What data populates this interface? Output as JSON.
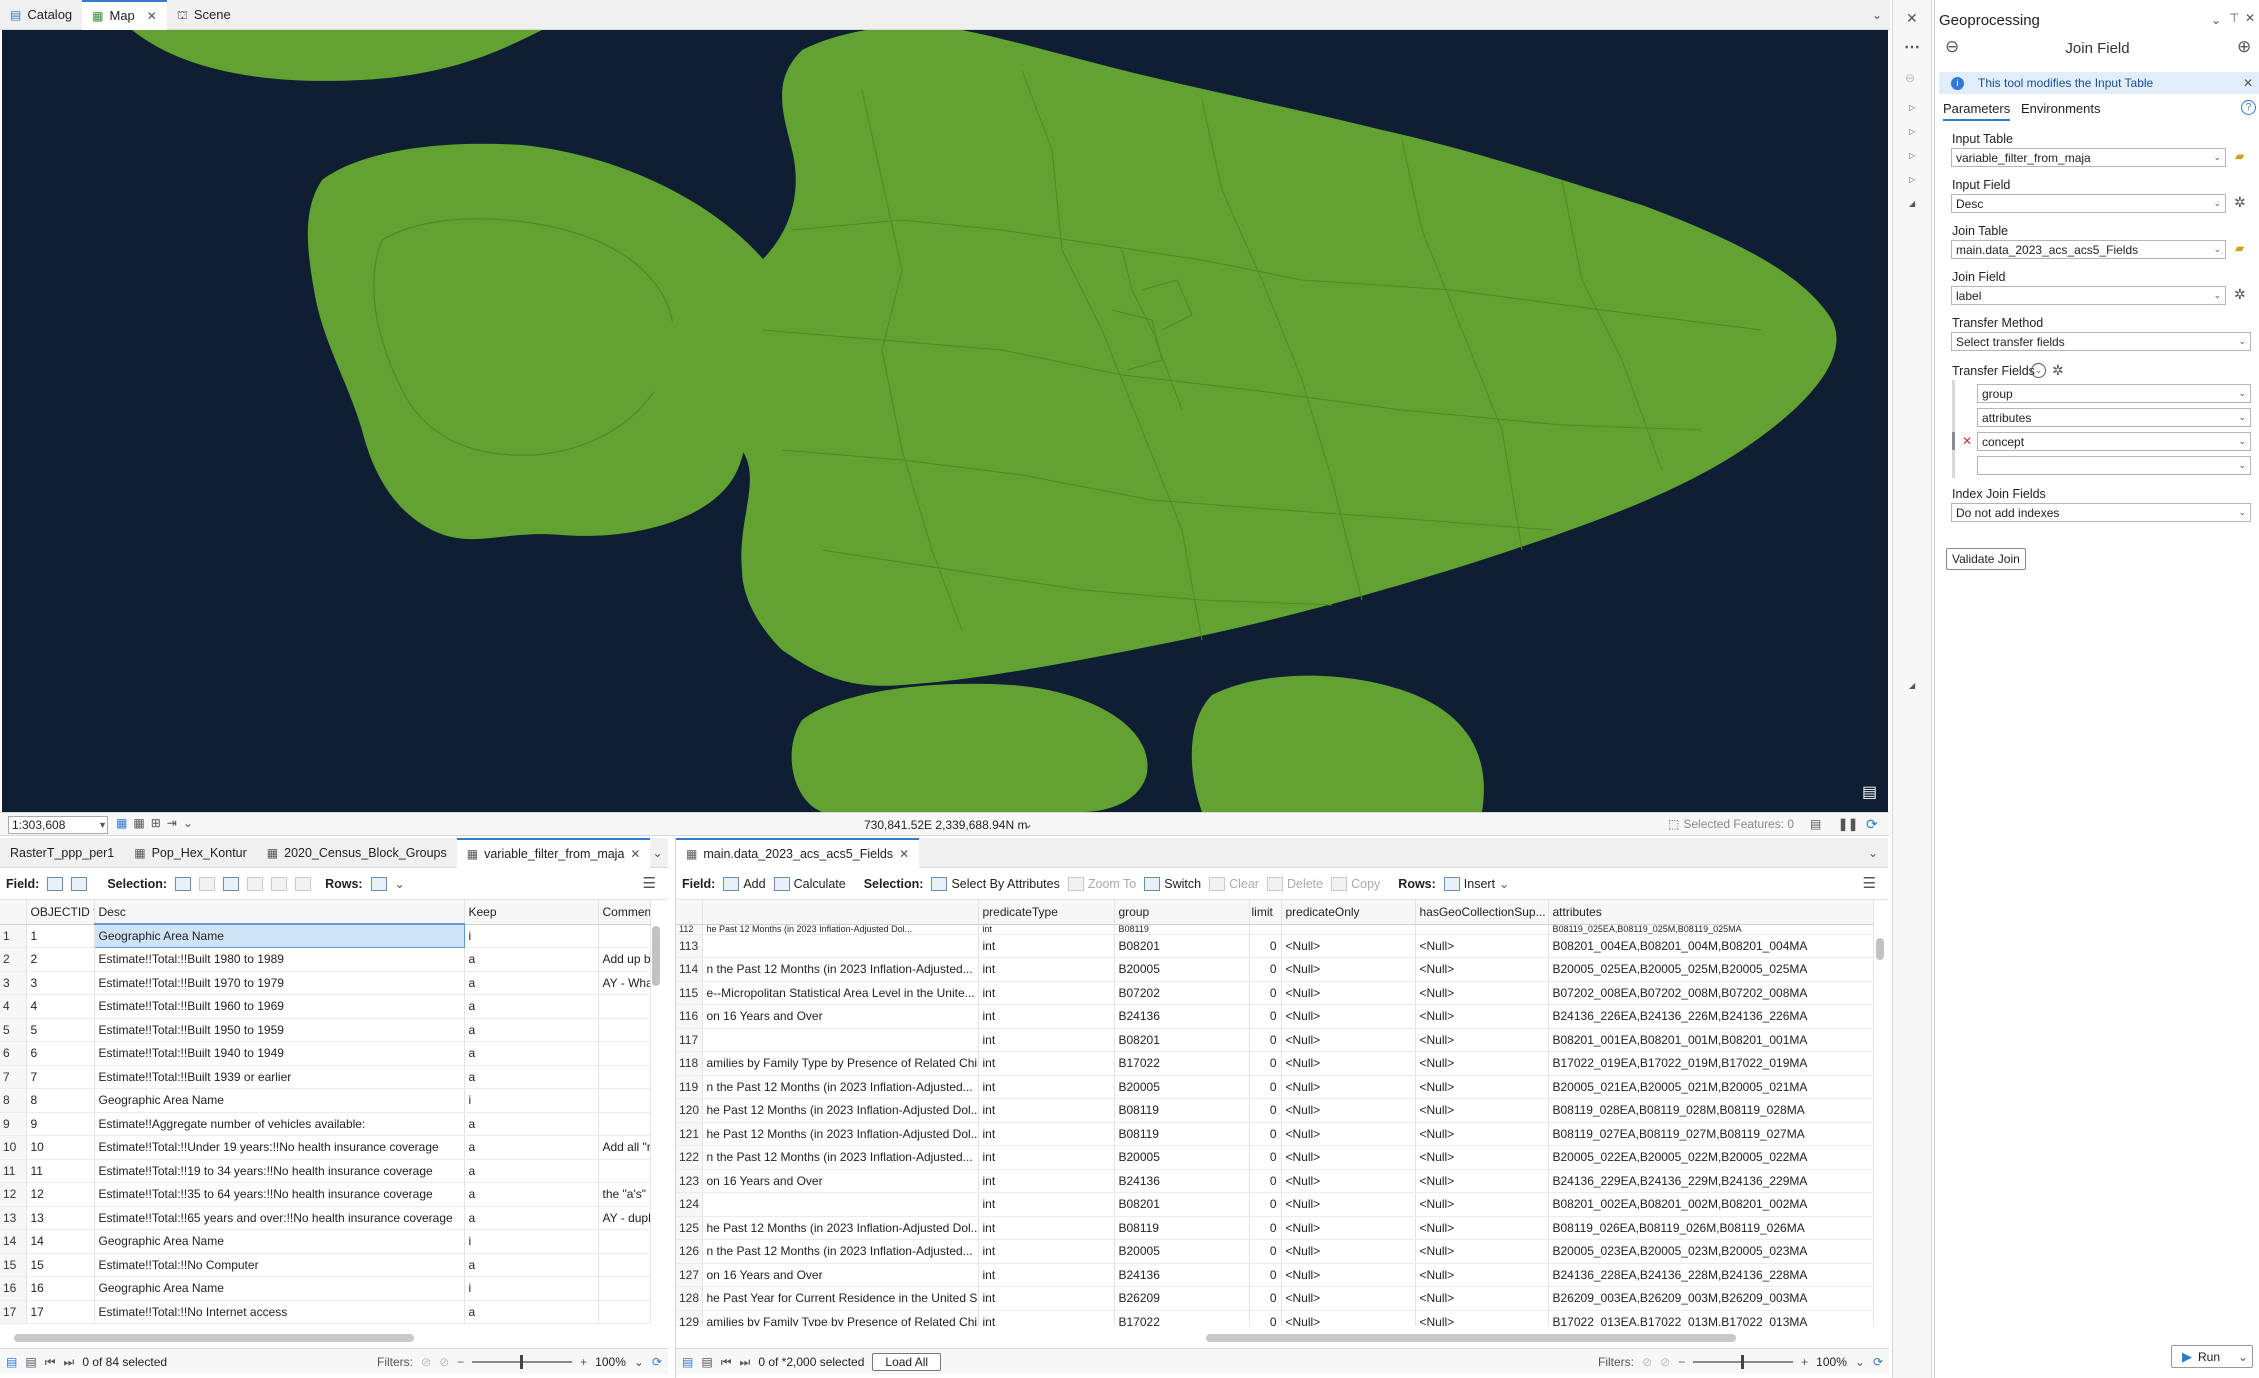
{
  "view_tabs": [
    {
      "label": "Catalog"
    },
    {
      "label": "Map"
    },
    {
      "label": "Scene"
    }
  ],
  "map": {
    "scale": "1:303,608",
    "coordinates": "730,841.52E 2,339,688.94N m",
    "selected_features": "Selected Features: 0",
    "colors": {
      "land": "#62a232",
      "water": "#0f1e33"
    }
  },
  "left_pane": {
    "tabs": [
      "RasterT_ppp_per1",
      "Pop_Hex_Kontur",
      "2020_Census_Block_Groups",
      "variable_filter_from_maja"
    ],
    "toolbar": {
      "field_label": "Field:",
      "selection_label": "Selection:",
      "rows_label": "Rows:"
    },
    "columns": [
      "OBJECTID *",
      "Desc",
      "Keep",
      "Commen"
    ],
    "rows": [
      {
        "n": "1",
        "id": "1",
        "desc": "Geographic Area Name",
        "keep": "i",
        "comment": ""
      },
      {
        "n": "2",
        "id": "2",
        "desc": "Estimate!!Total:!!Built 1980 to 1989",
        "keep": "a",
        "comment": "Add up b"
      },
      {
        "n": "3",
        "id": "3",
        "desc": "Estimate!!Total:!!Built 1970 to 1979",
        "keep": "a",
        "comment": "AY - What"
      },
      {
        "n": "4",
        "id": "4",
        "desc": "Estimate!!Total:!!Built 1960 to 1969",
        "keep": "a",
        "comment": ""
      },
      {
        "n": "5",
        "id": "5",
        "desc": "Estimate!!Total:!!Built 1950 to 1959",
        "keep": "a",
        "comment": ""
      },
      {
        "n": "6",
        "id": "6",
        "desc": "Estimate!!Total:!!Built 1940 to 1949",
        "keep": "a",
        "comment": ""
      },
      {
        "n": "7",
        "id": "7",
        "desc": "Estimate!!Total:!!Built 1939 or earlier",
        "keep": "a",
        "comment": ""
      },
      {
        "n": "8",
        "id": "8",
        "desc": "Geographic Area Name",
        "keep": "i",
        "comment": ""
      },
      {
        "n": "9",
        "id": "9",
        "desc": "Estimate!!Aggregate number of vehicles available:",
        "keep": "a",
        "comment": ""
      },
      {
        "n": "10",
        "id": "10",
        "desc": "Estimate!!Total:!!Under 19 years:!!No health insurance coverage",
        "keep": "a",
        "comment": "Add all \"r"
      },
      {
        "n": "11",
        "id": "11",
        "desc": "Estimate!!Total:!!19 to 34 years:!!No health insurance coverage",
        "keep": "a",
        "comment": ""
      },
      {
        "n": "12",
        "id": "12",
        "desc": "Estimate!!Total:!!35 to 64 years:!!No health insurance coverage",
        "keep": "a",
        "comment": "the \"a's\" i"
      },
      {
        "n": "13",
        "id": "13",
        "desc": "Estimate!!Total:!!65 years and over:!!No health insurance coverage",
        "keep": "a",
        "comment": "AY - dupli"
      },
      {
        "n": "14",
        "id": "14",
        "desc": "Geographic Area Name",
        "keep": "i",
        "comment": ""
      },
      {
        "n": "15",
        "id": "15",
        "desc": "Estimate!!Total:!!No Computer",
        "keep": "a",
        "comment": ""
      },
      {
        "n": "16",
        "id": "16",
        "desc": "Geographic Area Name",
        "keep": "i",
        "comment": ""
      },
      {
        "n": "17",
        "id": "17",
        "desc": "Estimate!!Total:!!No Internet access",
        "keep": "a",
        "comment": ""
      }
    ],
    "status": {
      "selected": "0 of 84 selected",
      "filters": "Filters:",
      "zoom": "100%"
    }
  },
  "right_pane": {
    "tab": "main.data_2023_acs_acs5_Fields",
    "toolbar": {
      "field_label": "Field:",
      "add": "Add",
      "calculate": "Calculate",
      "selection_label": "Selection:",
      "select_by_attributes": "Select By Attributes",
      "zoom_to": "Zoom To",
      "switch": "Switch",
      "clear": "Clear",
      "delete": "Delete",
      "copy": "Copy",
      "rows_label": "Rows:",
      "insert": "Insert"
    },
    "columns": [
      "",
      "predicateType",
      "group",
      "limit",
      "predicateOnly",
      "hasGeoCollectionSup...",
      "attributes"
    ],
    "partial_row": {
      "n": "112",
      "label": "he Past 12 Months (in 2023 Inflation-Adjusted Dol...",
      "type": "int",
      "group": "B08119",
      "attr": "B08119_025EA,B08119_025M,B08119_025MA"
    },
    "rows": [
      {
        "n": "113",
        "label": "",
        "type": "int",
        "group": "B08201",
        "limit": "0",
        "po": "<Null>",
        "geo": "<Null>",
        "attr": "B08201_004EA,B08201_004M,B08201_004MA"
      },
      {
        "n": "114",
        "label": "n the Past 12 Months (in 2023 Inflation-Adjusted...",
        "type": "int",
        "group": "B20005",
        "limit": "0",
        "po": "<Null>",
        "geo": "<Null>",
        "attr": "B20005_025EA,B20005_025M,B20005_025MA"
      },
      {
        "n": "115",
        "label": "e--Micropolitan Statistical Area Level in the Unite...",
        "type": "int",
        "group": "B07202",
        "limit": "0",
        "po": "<Null>",
        "geo": "<Null>",
        "attr": "B07202_008EA,B07202_008M,B07202_008MA"
      },
      {
        "n": "116",
        "label": "on 16 Years and Over",
        "type": "int",
        "group": "B24136",
        "limit": "0",
        "po": "<Null>",
        "geo": "<Null>",
        "attr": "B24136_226EA,B24136_226M,B24136_226MA"
      },
      {
        "n": "117",
        "label": "",
        "type": "int",
        "group": "B08201",
        "limit": "0",
        "po": "<Null>",
        "geo": "<Null>",
        "attr": "B08201_001EA,B08201_001M,B08201_001MA"
      },
      {
        "n": "118",
        "label": "amilies by Family Type by Presence of Related Chil...",
        "type": "int",
        "group": "B17022",
        "limit": "0",
        "po": "<Null>",
        "geo": "<Null>",
        "attr": "B17022_019EA,B17022_019M,B17022_019MA"
      },
      {
        "n": "119",
        "label": "n the Past 12 Months (in 2023 Inflation-Adjusted...",
        "type": "int",
        "group": "B20005",
        "limit": "0",
        "po": "<Null>",
        "geo": "<Null>",
        "attr": "B20005_021EA,B20005_021M,B20005_021MA"
      },
      {
        "n": "120",
        "label": "he Past 12 Months (in 2023 Inflation-Adjusted Dol...",
        "type": "int",
        "group": "B08119",
        "limit": "0",
        "po": "<Null>",
        "geo": "<Null>",
        "attr": "B08119_028EA,B08119_028M,B08119_028MA"
      },
      {
        "n": "121",
        "label": "he Past 12 Months (in 2023 Inflation-Adjusted Dol...",
        "type": "int",
        "group": "B08119",
        "limit": "0",
        "po": "<Null>",
        "geo": "<Null>",
        "attr": "B08119_027EA,B08119_027M,B08119_027MA"
      },
      {
        "n": "122",
        "label": "n the Past 12 Months (in 2023 Inflation-Adjusted...",
        "type": "int",
        "group": "B20005",
        "limit": "0",
        "po": "<Null>",
        "geo": "<Null>",
        "attr": "B20005_022EA,B20005_022M,B20005_022MA"
      },
      {
        "n": "123",
        "label": "on 16 Years and Over",
        "type": "int",
        "group": "B24136",
        "limit": "0",
        "po": "<Null>",
        "geo": "<Null>",
        "attr": "B24136_229EA,B24136_229M,B24136_229MA"
      },
      {
        "n": "124",
        "label": "",
        "type": "int",
        "group": "B08201",
        "limit": "0",
        "po": "<Null>",
        "geo": "<Null>",
        "attr": "B08201_002EA,B08201_002M,B08201_002MA"
      },
      {
        "n": "125",
        "label": "he Past 12 Months (in 2023 Inflation-Adjusted Dol...",
        "type": "int",
        "group": "B08119",
        "limit": "0",
        "po": "<Null>",
        "geo": "<Null>",
        "attr": "B08119_026EA,B08119_026M,B08119_026MA"
      },
      {
        "n": "126",
        "label": "n the Past 12 Months (in 2023 Inflation-Adjusted...",
        "type": "int",
        "group": "B20005",
        "limit": "0",
        "po": "<Null>",
        "geo": "<Null>",
        "attr": "B20005_023EA,B20005_023M,B20005_023MA"
      },
      {
        "n": "127",
        "label": "on 16 Years and Over",
        "type": "int",
        "group": "B24136",
        "limit": "0",
        "po": "<Null>",
        "geo": "<Null>",
        "attr": "B24136_228EA,B24136_228M,B24136_228MA"
      },
      {
        "n": "128",
        "label": "he Past Year for Current Residence in the United S...",
        "type": "int",
        "group": "B26209",
        "limit": "0",
        "po": "<Null>",
        "geo": "<Null>",
        "attr": "B26209_003EA,B26209_003M,B26209_003MA"
      },
      {
        "n": "129",
        "label": "amilies by Family Type by Presence of Related Chil...",
        "type": "int",
        "group": "B17022",
        "limit": "0",
        "po": "<Null>",
        "geo": "<Null>",
        "attr": "B17022_013EA,B17022_013M,B17022_013MA"
      }
    ],
    "status": {
      "selected": "0 of *2,000 selected",
      "load_all": "Load All",
      "filters": "Filters:",
      "zoom": "100%"
    }
  },
  "geoprocessing": {
    "panel_title": "Geoprocessing",
    "tool_title": "Join Field",
    "info": "This tool modifies the Input Table",
    "tabs": [
      "Parameters",
      "Environments"
    ],
    "input_table_label": "Input Table",
    "input_table": "variable_filter_from_maja",
    "input_field_label": "Input Field",
    "input_field": "Desc",
    "join_table_label": "Join Table",
    "join_table": "main.data_2023_acs_acs5_Fields",
    "join_field_label": "Join Field",
    "join_field": "label",
    "transfer_method_label": "Transfer Method",
    "transfer_method": "Select transfer fields",
    "transfer_fields_label": "Transfer Fields",
    "transfer_fields": [
      "group",
      "attributes",
      "concept",
      ""
    ],
    "index_join_label": "Index Join Fields",
    "index_join": "Do not add indexes",
    "validate": "Validate Join",
    "run": "Run"
  }
}
